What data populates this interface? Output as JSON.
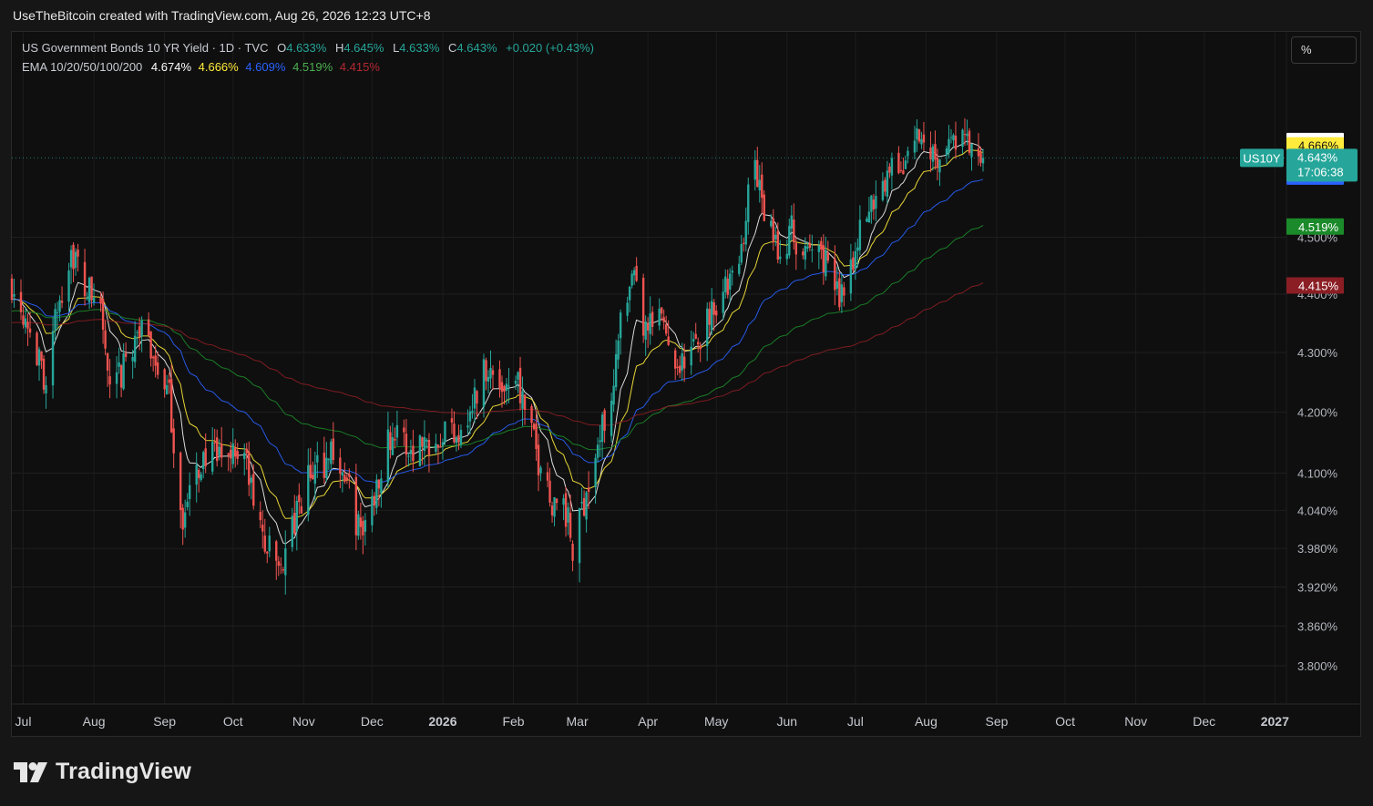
{
  "header": {
    "text": "UseTheBitcoin created with TradingView.com, Aug 26, 2026 12:23 UTC+8"
  },
  "legend": {
    "title": "US Government Bonds 10 YR Yield · 1D · TVC",
    "o_label": "O",
    "o_value": "4.633%",
    "h_label": "H",
    "h_value": "4.645%",
    "l_label": "L",
    "l_value": "4.633%",
    "c_label": "C",
    "c_value": "4.643%",
    "change": "+0.020 (+0.43%)",
    "ema_label": "EMA 10/20/50/100/200",
    "ema_values": [
      "4.674%",
      "4.666%",
      "4.609%",
      "4.519%",
      "4.415%"
    ]
  },
  "scale_button": "%",
  "footer": {
    "brand": "TradingView"
  },
  "colors": {
    "up": "#26a69a",
    "down": "#ef5350",
    "ema10": "#ffffff",
    "ema20": "#ffeb3b",
    "ema50": "#2962ff",
    "ema100": "#1b8a2a",
    "ema200": "#8b1e24",
    "ema10_text": "#ffffff",
    "ema20_text": "#ffeb3b",
    "ema50_text": "#2962ff",
    "ema100_text": "#4caf50",
    "ema200_text": "#b22833"
  },
  "chart_data": {
    "type": "candlestick",
    "symbol": "US10Y",
    "timeframe": "1D",
    "y_axis_ticks": [
      4.3,
      4.2,
      4.1,
      4.04,
      3.98,
      3.92,
      3.86,
      3.8
    ],
    "y_axis_tick_labels": [
      "4.300%",
      "4.200%",
      "4.100%",
      "4.040%",
      "3.980%",
      "3.920%",
      "3.860%",
      "3.800%"
    ],
    "hidden_tick_labels": [
      "4.500%",
      "4.400%"
    ],
    "x_axis_labels": [
      "Jul",
      "Aug",
      "Sep",
      "Oct",
      "Nov",
      "Dec",
      "2026",
      "Feb",
      "Mar",
      "Apr",
      "May",
      "Jun",
      "Jul",
      "Aug",
      "Sep",
      "Oct",
      "Nov",
      "Dec",
      "2027"
    ],
    "bold_x_labels": [
      "2026",
      "2027"
    ],
    "last_price": 4.643,
    "last_price_label": "4.643%",
    "countdown": "17:06:38",
    "symbol_tag": "US10Y",
    "price_anchors": [
      {
        "date": "2025-06-26",
        "close": 4.42
      },
      {
        "date": "2025-07-03",
        "close": 4.36
      },
      {
        "date": "2025-07-10",
        "close": 4.25
      },
      {
        "date": "2025-07-16",
        "close": 4.37
      },
      {
        "date": "2025-07-22",
        "close": 4.48
      },
      {
        "date": "2025-07-28",
        "close": 4.41
      },
      {
        "date": "2025-08-04",
        "close": 4.38
      },
      {
        "date": "2025-08-08",
        "close": 4.22
      },
      {
        "date": "2025-08-14",
        "close": 4.27
      },
      {
        "date": "2025-08-20",
        "close": 4.34
      },
      {
        "date": "2025-08-27",
        "close": 4.3
      },
      {
        "date": "2025-09-03",
        "close": 4.22
      },
      {
        "date": "2025-09-09",
        "close": 4.02
      },
      {
        "date": "2025-09-12",
        "close": 4.06
      },
      {
        "date": "2025-09-18",
        "close": 4.13
      },
      {
        "date": "2025-09-24",
        "close": 4.12
      },
      {
        "date": "2025-09-30",
        "close": 4.14
      },
      {
        "date": "2025-10-06",
        "close": 4.13
      },
      {
        "date": "2025-10-10",
        "close": 4.05
      },
      {
        "date": "2025-10-15",
        "close": 3.99
      },
      {
        "date": "2025-10-20",
        "close": 3.95
      },
      {
        "date": "2025-10-24",
        "close": 3.97
      },
      {
        "date": "2025-10-29",
        "close": 4.03
      },
      {
        "date": "2025-11-03",
        "close": 4.09
      },
      {
        "date": "2025-11-10",
        "close": 4.12
      },
      {
        "date": "2025-11-14",
        "close": 4.14
      },
      {
        "date": "2025-11-20",
        "close": 4.08
      },
      {
        "date": "2025-11-26",
        "close": 4.0
      },
      {
        "date": "2025-12-01",
        "close": 4.05
      },
      {
        "date": "2025-12-05",
        "close": 4.12
      },
      {
        "date": "2025-12-10",
        "close": 4.17
      },
      {
        "date": "2025-12-16",
        "close": 4.14
      },
      {
        "date": "2025-12-22",
        "close": 4.15
      },
      {
        "date": "2025-12-31",
        "close": 4.17
      },
      {
        "date": "2026-01-07",
        "close": 4.17
      },
      {
        "date": "2026-01-13",
        "close": 4.2
      },
      {
        "date": "2026-01-20",
        "close": 4.28
      },
      {
        "date": "2026-01-26",
        "close": 4.24
      },
      {
        "date": "2026-02-02",
        "close": 4.27
      },
      {
        "date": "2026-02-06",
        "close": 4.2
      },
      {
        "date": "2026-02-12",
        "close": 4.12
      },
      {
        "date": "2026-02-18",
        "close": 4.06
      },
      {
        "date": "2026-02-24",
        "close": 4.04
      },
      {
        "date": "2026-02-27",
        "close": 3.97
      },
      {
        "date": "2026-03-04",
        "close": 4.06
      },
      {
        "date": "2026-03-10",
        "close": 4.14
      },
      {
        "date": "2026-03-16",
        "close": 4.24
      },
      {
        "date": "2026-03-20",
        "close": 4.34
      },
      {
        "date": "2026-03-26",
        "close": 4.42
      },
      {
        "date": "2026-03-31",
        "close": 4.33
      },
      {
        "date": "2026-04-07",
        "close": 4.36
      },
      {
        "date": "2026-04-13",
        "close": 4.29
      },
      {
        "date": "2026-04-17",
        "close": 4.28
      },
      {
        "date": "2026-04-23",
        "close": 4.32
      },
      {
        "date": "2026-04-29",
        "close": 4.38
      },
      {
        "date": "2026-05-05",
        "close": 4.41
      },
      {
        "date": "2026-05-11",
        "close": 4.44
      },
      {
        "date": "2026-05-15",
        "close": 4.59
      },
      {
        "date": "2026-05-19",
        "close": 4.62
      },
      {
        "date": "2026-05-22",
        "close": 4.53
      },
      {
        "date": "2026-05-28",
        "close": 4.48
      },
      {
        "date": "2026-06-03",
        "close": 4.51
      },
      {
        "date": "2026-06-09",
        "close": 4.46
      },
      {
        "date": "2026-06-15",
        "close": 4.49
      },
      {
        "date": "2026-06-19",
        "close": 4.44
      },
      {
        "date": "2026-06-24",
        "close": 4.4
      },
      {
        "date": "2026-06-29",
        "close": 4.46
      },
      {
        "date": "2026-07-06",
        "close": 4.54
      },
      {
        "date": "2026-07-10",
        "close": 4.58
      },
      {
        "date": "2026-07-16",
        "close": 4.62
      },
      {
        "date": "2026-07-22",
        "close": 4.63
      },
      {
        "date": "2026-07-28",
        "close": 4.68
      },
      {
        "date": "2026-08-03",
        "close": 4.66
      },
      {
        "date": "2026-08-07",
        "close": 4.65
      },
      {
        "date": "2026-08-13",
        "close": 4.68
      },
      {
        "date": "2026-08-19",
        "close": 4.67
      },
      {
        "date": "2026-08-24",
        "close": 4.63
      },
      {
        "date": "2026-08-26",
        "close": 4.643
      }
    ],
    "ema_series": [
      {
        "name": "EMA 10",
        "last": 4.674,
        "last_label": "4.674%"
      },
      {
        "name": "EMA 20",
        "last": 4.666,
        "last_label": "4.666%"
      },
      {
        "name": "EMA 50",
        "last": 4.609,
        "last_label": "4.609%"
      },
      {
        "name": "EMA 100",
        "last": 4.519,
        "last_label": "4.519%"
      },
      {
        "name": "EMA 200",
        "last": 4.415,
        "last_label": "4.415%"
      }
    ],
    "date_range": [
      "2025-06-26",
      "2026-08-26"
    ],
    "grid": true,
    "log_scale": true
  }
}
